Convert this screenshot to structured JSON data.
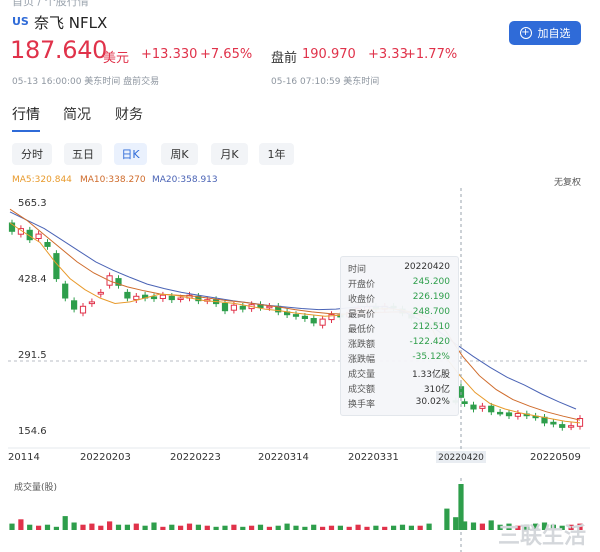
{
  "breadcrumb": "首页 / 个股行情",
  "stock": {
    "market": "US",
    "name": "奈飞 NFLX"
  },
  "add_button": "加自选",
  "quote": {
    "price": "187.640",
    "currency": "美元",
    "change": "+13.330",
    "change_pct": "+7.65%",
    "time": "05-13 16:00:00 美东时间 盘前交易",
    "pre_label": "盘前",
    "pre_price": "190.970",
    "pre_change": "+3.33",
    "pre_change_pct": "+1.77%",
    "pre_time": "05-16 07:10:59 美东时间"
  },
  "tabs": [
    "行情",
    "简况",
    "财务"
  ],
  "periods": [
    "分时",
    "五日",
    "日K",
    "周K",
    "月K",
    "1年"
  ],
  "active_period": "日K",
  "ma": {
    "ma5": "MA5:320.844",
    "ma10": "MA10:338.270",
    "ma20": "MA20:358.913"
  },
  "adjust": "无复权",
  "volume_title": "成交量(股)",
  "watermark": "三联生活",
  "colors": {
    "up": "#e0324a",
    "down": "#2e9e4b",
    "ma5": "#e89a2c",
    "ma10": "#cf6b2b",
    "ma20": "#4a63b5",
    "accent": "#2f6bd8"
  },
  "chart_data": {
    "type": "candlestick",
    "y_ticks": [
      "565.3",
      "428.4",
      "291.5",
      "154.6"
    ],
    "x_ticks": [
      "20114",
      "20220203",
      "20220223",
      "20220314",
      "20220331",
      "20220420",
      "20220509"
    ],
    "ylim": [
      154.6,
      565.3
    ],
    "dashed_level": 291.5,
    "crosshair_date": "20220420",
    "candles": [
      {
        "o": 540,
        "c": 525
      },
      {
        "o": 520,
        "c": 530
      },
      {
        "o": 527,
        "c": 510
      },
      {
        "o": 512,
        "c": 520
      },
      {
        "o": 505,
        "c": 498
      },
      {
        "o": 485,
        "c": 440
      },
      {
        "o": 430,
        "c": 405
      },
      {
        "o": 400,
        "c": 385
      },
      {
        "o": 378,
        "c": 390
      },
      {
        "o": 395,
        "c": 398
      },
      {
        "o": 412,
        "c": 415
      },
      {
        "o": 428,
        "c": 445
      },
      {
        "o": 440,
        "c": 428
      },
      {
        "o": 415,
        "c": 405
      },
      {
        "o": 402,
        "c": 408
      },
      {
        "o": 410,
        "c": 405
      },
      {
        "o": 407,
        "c": 404
      },
      {
        "o": 404,
        "c": 410
      },
      {
        "o": 408,
        "c": 402
      },
      {
        "o": 403,
        "c": 405
      },
      {
        "o": 405,
        "c": 410
      },
      {
        "o": 408,
        "c": 400
      },
      {
        "o": 400,
        "c": 402
      },
      {
        "o": 402,
        "c": 395
      },
      {
        "o": 395,
        "c": 382
      },
      {
        "o": 383,
        "c": 392
      },
      {
        "o": 390,
        "c": 385
      },
      {
        "o": 386,
        "c": 393
      },
      {
        "o": 393,
        "c": 388
      },
      {
        "o": 388,
        "c": 390
      },
      {
        "o": 390,
        "c": 380
      },
      {
        "o": 380,
        "c": 375
      },
      {
        "o": 375,
        "c": 372
      },
      {
        "o": 372,
        "c": 368
      },
      {
        "o": 368,
        "c": 360
      },
      {
        "o": 356,
        "c": 367
      },
      {
        "o": 366,
        "c": 375
      },
      {
        "o": 374,
        "c": 371
      },
      {
        "o": 371,
        "c": 379
      },
      {
        "o": 378,
        "c": 386
      },
      {
        "o": 384,
        "c": 389
      },
      {
        "o": 390,
        "c": 385
      },
      {
        "o": 385,
        "c": 390
      },
      {
        "o": 390,
        "c": 388
      },
      {
        "o": 385,
        "c": 378
      },
      {
        "o": 376,
        "c": 369
      },
      {
        "o": 375,
        "c": 378
      },
      {
        "o": 356,
        "c": 350
      },
      {
        "o": 245.2,
        "c": 226.19
      },
      {
        "o": 222,
        "c": 220
      },
      {
        "o": 220,
        "c": 219
      },
      {
        "o": 218,
        "c": 215
      },
      {
        "o": 212,
        "c": 205
      },
      {
        "o": 206,
        "c": 210
      },
      {
        "o": 210,
        "c": 200
      },
      {
        "o": 199,
        "c": 198
      },
      {
        "o": 198,
        "c": 193
      },
      {
        "o": 192,
        "c": 197
      },
      {
        "o": 196,
        "c": 193
      },
      {
        "o": 192,
        "c": 190
      },
      {
        "o": 190,
        "c": 180
      },
      {
        "o": 181,
        "c": 178
      },
      {
        "o": 177,
        "c": 172
      },
      {
        "o": 173,
        "c": 175
      },
      {
        "o": 174,
        "c": 188
      }
    ],
    "ma5_values": [
      540,
      522,
      505,
      470,
      440,
      420,
      405,
      395,
      398,
      405,
      412,
      410,
      405,
      400,
      398,
      395,
      390,
      385,
      382,
      378,
      375,
      372,
      374,
      380,
      384,
      386,
      384,
      378,
      358,
      300,
      265,
      235,
      215,
      205,
      198,
      193,
      188,
      183,
      180
    ],
    "ma10_values": [
      565,
      545,
      520,
      495,
      470,
      450,
      435,
      425,
      418,
      412,
      410,
      408,
      404,
      400,
      397,
      393,
      389,
      384,
      380,
      377,
      376,
      377,
      379,
      380,
      379,
      370,
      345,
      300,
      265,
      240,
      222,
      210,
      200,
      192,
      185
    ],
    "ma20_values": [
      560,
      545,
      530,
      510,
      490,
      470,
      455,
      442,
      430,
      422,
      415,
      410,
      405,
      400,
      396,
      392,
      389,
      386,
      384,
      385,
      388,
      390,
      389,
      380,
      364,
      345,
      322,
      300,
      280,
      262,
      248,
      232,
      218,
      205
    ],
    "volume_values": [
      6,
      10,
      5,
      4,
      5,
      3,
      13,
      7,
      5,
      6,
      4,
      8,
      5,
      5,
      6,
      4,
      7,
      3,
      5,
      4,
      6,
      5,
      4,
      3,
      4,
      5,
      3,
      4,
      5,
      3,
      4,
      6,
      4,
      3,
      5,
      3,
      4,
      4,
      3,
      5,
      3,
      4,
      3,
      4,
      5,
      4,
      4,
      6,
      43,
      20,
      12,
      8,
      7,
      6,
      9,
      5,
      6,
      4,
      5,
      6,
      7,
      5,
      4,
      5,
      6
    ],
    "tooltip": [
      {
        "label": "时间",
        "value": "20220420"
      },
      {
        "label": "开盘价",
        "value": "245.200"
      },
      {
        "label": "收盘价",
        "value": "226.190"
      },
      {
        "label": "最高价",
        "value": "248.700"
      },
      {
        "label": "最低价",
        "value": "212.510"
      },
      {
        "label": "涨跌额",
        "value": "-122.420"
      },
      {
        "label": "涨跌幅",
        "value": "-35.12%"
      },
      {
        "label": "成交量",
        "value": "1.33亿股"
      },
      {
        "label": "成交额",
        "value": "310亿"
      },
      {
        "label": "换手率",
        "value": "30.02%"
      }
    ]
  }
}
